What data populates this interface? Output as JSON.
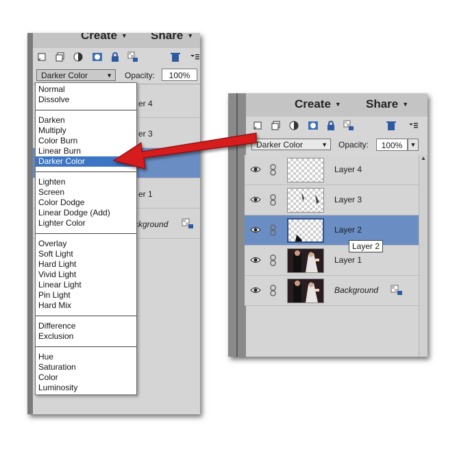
{
  "header": {
    "create_label": "Create",
    "share_label": "Share"
  },
  "toolbar": {
    "icons": [
      "new-layer-icon",
      "duplicate-icon",
      "adjustment-icon",
      "mask-icon",
      "lock-icon",
      "lock-transparent-icon",
      "trash-icon",
      "panel-menu-icon"
    ]
  },
  "blend": {
    "mode": "Darker Color",
    "opacity_label": "Opacity:",
    "opacity_value": "100%"
  },
  "layers": [
    {
      "name": "Layer 4",
      "thumb": "transparent"
    },
    {
      "name": "Layer 3",
      "thumb": "transparent"
    },
    {
      "name": "Layer 2",
      "thumb": "transparent",
      "selected": true
    },
    {
      "name": "Layer 1",
      "thumb": "photo"
    },
    {
      "name": "Background",
      "thumb": "photo",
      "italic": true,
      "locked": true
    }
  ],
  "tooltip": "Layer 2",
  "left_panel": {
    "partial_layers": [
      "er 4",
      "er 3",
      "er 1",
      "ckground"
    ]
  },
  "blend_menu": {
    "groups": [
      [
        "Normal",
        "Dissolve"
      ],
      [
        "Darken",
        "Multiply",
        "Color Burn",
        "Linear Burn",
        "Darker Color"
      ],
      [
        "Lighten",
        "Screen",
        "Color Dodge",
        "Linear Dodge (Add)",
        "Lighter Color"
      ],
      [
        "Overlay",
        "Soft Light",
        "Hard Light",
        "Vivid Light",
        "Linear Light",
        "Pin Light",
        "Hard Mix"
      ],
      [
        "Difference",
        "Exclusion"
      ],
      [
        "Hue",
        "Saturation",
        "Color",
        "Luminosity"
      ]
    ],
    "highlighted": "Darker Color"
  },
  "colors": {
    "selection": "#6a8ec4",
    "menu_highlight": "#3c75c2",
    "arrow": "#d61f1f"
  }
}
